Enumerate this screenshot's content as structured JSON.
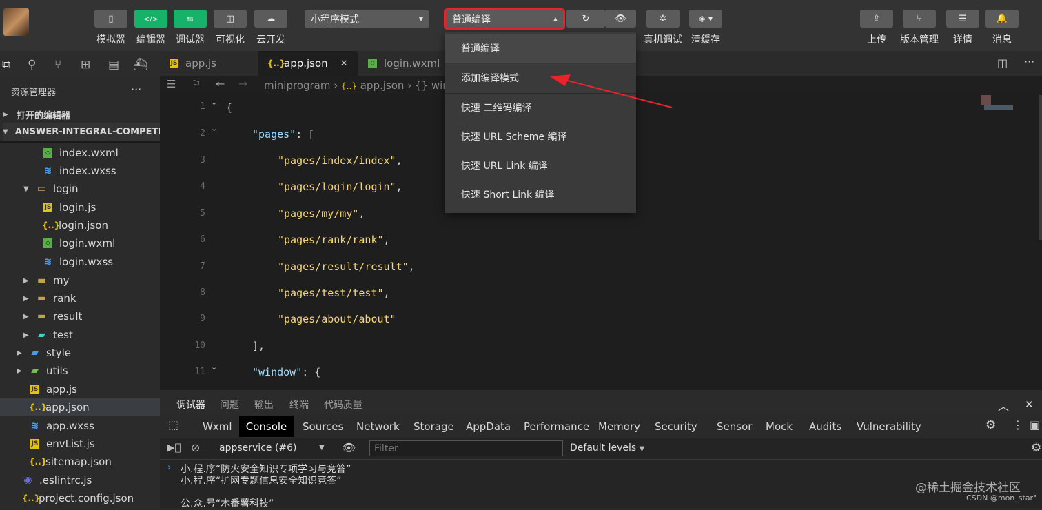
{
  "toolbar": {
    "buttons": [
      {
        "label": "模拟器",
        "icon": "phone-icon"
      },
      {
        "label": "编辑器",
        "icon": "code-icon"
      },
      {
        "label": "调试器",
        "icon": "debug-icon"
      },
      {
        "label": "可视化",
        "icon": "layout-icon"
      },
      {
        "label": "云开发",
        "icon": "cloud-icon"
      }
    ],
    "mode_select": "小程序模式",
    "compile_select": "普通编译",
    "right_buttons": [
      {
        "label": "真机调试",
        "icon": "bug-icon"
      },
      {
        "label": "清缓存",
        "icon": "layers-icon"
      }
    ],
    "far_right_buttons": [
      {
        "label": "上传",
        "icon": "upload-icon"
      },
      {
        "label": "版本管理",
        "icon": "branch-icon"
      },
      {
        "label": "详情",
        "icon": "menu-icon"
      },
      {
        "label": "消息",
        "icon": "bell-icon"
      }
    ]
  },
  "compile_menu": {
    "items": [
      "普通编译",
      "添加编译模式",
      "快速 二维码编译",
      "快速 URL Scheme 编译",
      "快速 URL Link 编译",
      "快速 Short Link 编译"
    ]
  },
  "sidebar": {
    "title": "资源管理器",
    "more": "···",
    "open_editors": "打开的编辑器",
    "project": "ANSWER-INTEGRAL-COMPETITI...",
    "tree": [
      {
        "label": "index.wxml",
        "type": "wxml"
      },
      {
        "label": "index.wxss",
        "type": "wxss"
      },
      {
        "label": "login",
        "type": "folder-open"
      },
      {
        "label": "login.js",
        "type": "js"
      },
      {
        "label": "login.json",
        "type": "json"
      },
      {
        "label": "login.wxml",
        "type": "wxml"
      },
      {
        "label": "login.wxss",
        "type": "wxss"
      },
      {
        "label": "my",
        "type": "folder"
      },
      {
        "label": "rank",
        "type": "folder"
      },
      {
        "label": "result",
        "type": "folder"
      },
      {
        "label": "test",
        "type": "folder"
      },
      {
        "label": "style",
        "type": "folder"
      },
      {
        "label": "utils",
        "type": "folder"
      },
      {
        "label": "app.js",
        "type": "js"
      },
      {
        "label": "app.json",
        "type": "json"
      },
      {
        "label": "app.wxss",
        "type": "wxss"
      },
      {
        "label": "envList.js",
        "type": "js"
      },
      {
        "label": "sitemap.json",
        "type": "json"
      },
      {
        "label": ".eslintrc.js",
        "type": "eslint"
      },
      {
        "label": "project.config.json",
        "type": "json"
      }
    ]
  },
  "editor": {
    "tabs": [
      "app.js",
      "app.json",
      "login.wxml"
    ],
    "close_glyph": "✕",
    "breadcrumb": [
      "miniprogram",
      "app.json",
      "win"
    ],
    "lines": [
      {
        "n": "1",
        "text": "{"
      },
      {
        "n": "2",
        "key": "\"pages\"",
        "rest": ": ["
      },
      {
        "n": "3",
        "str": "\"pages/index/index\"",
        "rest": ","
      },
      {
        "n": "4",
        "str": "\"pages/login/login\"",
        "rest": ","
      },
      {
        "n": "5",
        "str": "\"pages/my/my\"",
        "rest": ","
      },
      {
        "n": "6",
        "str": "\"pages/rank/rank\"",
        "rest": ","
      },
      {
        "n": "7",
        "str": "\"pages/result/result\"",
        "rest": ","
      },
      {
        "n": "8",
        "str": "\"pages/test/test\"",
        "rest": ","
      },
      {
        "n": "9",
        "str": "\"pages/about/about\"",
        "rest": ""
      },
      {
        "n": "10",
        "text": "],"
      },
      {
        "n": "11",
        "key": "\"window\"",
        "rest": ": {"
      }
    ]
  },
  "panel": {
    "tabs": [
      "调试器",
      "问题",
      "输出",
      "终端",
      "代码质量"
    ],
    "devtools_tabs": [
      "Wxml",
      "Console",
      "Sources",
      "Network",
      "Storage",
      "AppData",
      "Performance",
      "Memory",
      "Security",
      "Sensor",
      "Mock",
      "Audits",
      "Vulnerability"
    ],
    "context_select": "appservice (#6)",
    "filter_placeholder": "Filter",
    "levels": "Default levels",
    "console_lines": [
      "小.程.序“防火安全知识专项学习与竞答”",
      "小.程.序“护网专题信息安全知识竞答”",
      "公.众.号“木番薯科技”"
    ]
  },
  "watermark": {
    "main": "@稀土掘金技术社区",
    "sub": "CSDN @mon_star°"
  },
  "colors": {
    "highlight_red": "#e8232a",
    "green_button": "#17b26a",
    "string": "#f4d675"
  }
}
